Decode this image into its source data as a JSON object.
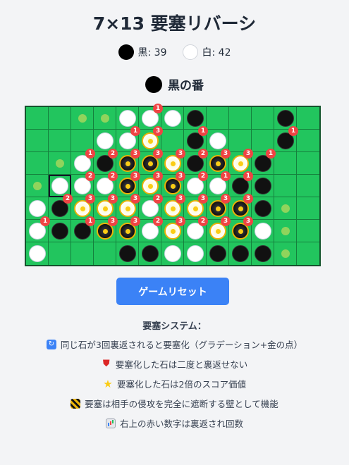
{
  "title": "7×13 要塞リバーシ",
  "score": {
    "black_label": "黒: 39",
    "white_label": "白: 42"
  },
  "turn": {
    "label": "黒の番",
    "color": "black"
  },
  "board": {
    "rows": 7,
    "cols": 13,
    "selected": [
      3,
      1
    ],
    "cells": [
      [
        [
          ".",
          0
        ],
        [
          ".",
          0
        ],
        [
          "h",
          0
        ],
        [
          "h",
          0
        ],
        [
          "W",
          0
        ],
        [
          "W",
          1
        ],
        [
          "W",
          0
        ],
        [
          "B",
          0
        ],
        [
          ".",
          0
        ],
        [
          ".",
          0
        ],
        [
          ".",
          0
        ],
        [
          "B",
          0
        ],
        [
          ".",
          0
        ]
      ],
      [
        [
          ".",
          0
        ],
        [
          ".",
          0
        ],
        [
          ".",
          0
        ],
        [
          "W",
          0
        ],
        [
          "W",
          1
        ],
        [
          "W",
          3
        ],
        [
          ".",
          0
        ],
        [
          "B",
          1
        ],
        [
          "W",
          0
        ],
        [
          ".",
          0
        ],
        [
          ".",
          0
        ],
        [
          "B",
          1
        ],
        [
          ".",
          0
        ]
      ],
      [
        [
          ".",
          0
        ],
        [
          "h",
          0
        ],
        [
          "W",
          1
        ],
        [
          "B",
          2
        ],
        [
          "B",
          3
        ],
        [
          "B",
          3
        ],
        [
          "W",
          3
        ],
        [
          "B",
          2
        ],
        [
          "B",
          3
        ],
        [
          "W",
          3
        ],
        [
          "B",
          1
        ],
        [
          ".",
          0
        ],
        [
          ".",
          0
        ]
      ],
      [
        [
          "h",
          0
        ],
        [
          "W",
          0
        ],
        [
          "W",
          2
        ],
        [
          "W",
          2
        ],
        [
          "B",
          3
        ],
        [
          "W",
          3
        ],
        [
          "B",
          3
        ],
        [
          "W",
          2
        ],
        [
          "W",
          1
        ],
        [
          "B",
          1
        ],
        [
          "B",
          0
        ],
        [
          ".",
          0
        ],
        [
          ".",
          0
        ]
      ],
      [
        [
          "W",
          0
        ],
        [
          "B",
          2
        ],
        [
          "W",
          3
        ],
        [
          "W",
          3
        ],
        [
          "W",
          3
        ],
        [
          "W",
          2
        ],
        [
          "W",
          3
        ],
        [
          "W",
          3
        ],
        [
          "B",
          3
        ],
        [
          "B",
          3
        ],
        [
          "B",
          0
        ],
        [
          "h",
          0
        ],
        [
          ".",
          0
        ]
      ],
      [
        [
          "W",
          1
        ],
        [
          "B",
          0
        ],
        [
          "B",
          1
        ],
        [
          "B",
          3
        ],
        [
          "B",
          3
        ],
        [
          "W",
          2
        ],
        [
          "W",
          3
        ],
        [
          "W",
          2
        ],
        [
          "W",
          3
        ],
        [
          "B",
          3
        ],
        [
          "W",
          0
        ],
        [
          "h",
          0
        ],
        [
          ".",
          0
        ]
      ],
      [
        [
          "W",
          0
        ],
        [
          ".",
          0
        ],
        [
          ".",
          0
        ],
        [
          ".",
          0
        ],
        [
          "B",
          0
        ],
        [
          "B",
          0
        ],
        [
          "W",
          0
        ],
        [
          "W",
          0
        ],
        [
          "B",
          0
        ],
        [
          "B",
          0
        ],
        [
          "B",
          0
        ],
        [
          "h",
          0
        ],
        [
          ".",
          0
        ]
      ]
    ]
  },
  "reset_button": "ゲームリセット",
  "rules": {
    "title": "要塞システム：",
    "items": [
      {
        "icon": "sync-icon",
        "text": "同じ石が3回裏返されると要塞化（グラデーション+金の点）"
      },
      {
        "icon": "shield-icon",
        "text": "要塞化した石は二度と裏返せない"
      },
      {
        "icon": "star-icon",
        "text": "要塞化した石は2倍のスコア価値"
      },
      {
        "icon": "barrier-icon",
        "text": "要塞は相手の侵攻を完全に遮断する壁として機能"
      },
      {
        "icon": "bar-chart-icon",
        "text": "右上の赤い数字は裏返され回数"
      }
    ]
  },
  "colors": {
    "board_green": "#22c55e",
    "board_border": "#14532d",
    "badge_red": "#ef4444",
    "fortress_gold": "#eab308",
    "button_blue": "#3b82f6"
  }
}
